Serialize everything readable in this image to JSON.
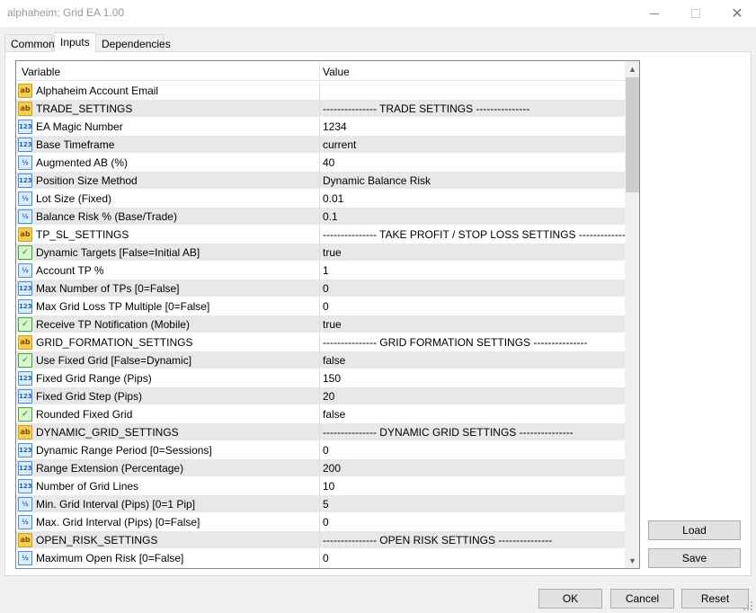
{
  "window": {
    "title": "alphaheim; Grid EA 1.00",
    "minimize_glyph": "",
    "maximize_glyph": "",
    "close_glyph": "✕"
  },
  "tabs": [
    {
      "label": "Common"
    },
    {
      "label": "Inputs"
    },
    {
      "label": "Dependencies"
    }
  ],
  "grid": {
    "headers": {
      "variable": "Variable",
      "value": "Value"
    },
    "rows": [
      {
        "icon": "ab",
        "variable": "Alphaheim Account Email",
        "value": ""
      },
      {
        "icon": "ab",
        "variable": "TRADE_SETTINGS",
        "value": "--------------- TRADE SETTINGS ---------------"
      },
      {
        "icon": "123",
        "variable": "EA Magic Number",
        "value": "1234"
      },
      {
        "icon": "123",
        "variable": "Base Timeframe",
        "value": "current"
      },
      {
        "icon": "1/2",
        "variable": "Augmented AB (%)",
        "value": "40"
      },
      {
        "icon": "123",
        "variable": "Position Size Method",
        "value": "Dynamic Balance Risk"
      },
      {
        "icon": "1/2",
        "variable": "Lot Size (Fixed)",
        "value": "0.01"
      },
      {
        "icon": "1/2",
        "variable": "Balance Risk % (Base/Trade)",
        "value": "0.1"
      },
      {
        "icon": "ab",
        "variable": "TP_SL_SETTINGS",
        "value": "--------------- TAKE PROFIT / STOP LOSS SETTINGS ---------------"
      },
      {
        "icon": "bool",
        "variable": "Dynamic Targets [False=Initial AB]",
        "value": "true"
      },
      {
        "icon": "1/2",
        "variable": "Account TP %",
        "value": "1"
      },
      {
        "icon": "123",
        "variable": "Max Number of TPs [0=False]",
        "value": "0"
      },
      {
        "icon": "123",
        "variable": "Max Grid Loss TP Multiple [0=False]",
        "value": "0"
      },
      {
        "icon": "bool",
        "variable": "Receive TP Notification (Mobile)",
        "value": "true"
      },
      {
        "icon": "ab",
        "variable": "GRID_FORMATION_SETTINGS",
        "value": "--------------- GRID FORMATION SETTINGS ---------------"
      },
      {
        "icon": "bool",
        "variable": "Use Fixed Grid [False=Dynamic]",
        "value": "false"
      },
      {
        "icon": "123",
        "variable": "Fixed Grid Range (Pips)",
        "value": "150"
      },
      {
        "icon": "123",
        "variable": "Fixed Grid Step (Pips)",
        "value": "20"
      },
      {
        "icon": "bool",
        "variable": "Rounded Fixed Grid",
        "value": "false"
      },
      {
        "icon": "ab",
        "variable": "DYNAMIC_GRID_SETTINGS",
        "value": "--------------- DYNAMIC GRID SETTINGS ---------------"
      },
      {
        "icon": "123",
        "variable": "Dynamic Range Period [0=Sessions]",
        "value": "0"
      },
      {
        "icon": "123",
        "variable": "Range Extension (Percentage)",
        "value": "200"
      },
      {
        "icon": "123",
        "variable": "Number of Grid Lines",
        "value": "10"
      },
      {
        "icon": "1/2",
        "variable": "Min. Grid Interval (Pips) [0=1 Pip]",
        "value": "5"
      },
      {
        "icon": "1/2",
        "variable": "Max. Grid Interval (Pips) [0=False]",
        "value": "0"
      },
      {
        "icon": "ab",
        "variable": "OPEN_RISK_SETTINGS",
        "value": "--------------- OPEN RISK SETTINGS ---------------"
      },
      {
        "icon": "1/2",
        "variable": "Maximum Open Risk [0=False]",
        "value": "0"
      }
    ]
  },
  "buttons": {
    "load": "Load",
    "save": "Save",
    "ok": "OK",
    "cancel": "Cancel",
    "reset": "Reset"
  },
  "icons": {
    "ab": "string-type-icon",
    "123": "integer-type-icon",
    "1/2": "double-type-icon",
    "bool": "boolean-type-icon"
  }
}
